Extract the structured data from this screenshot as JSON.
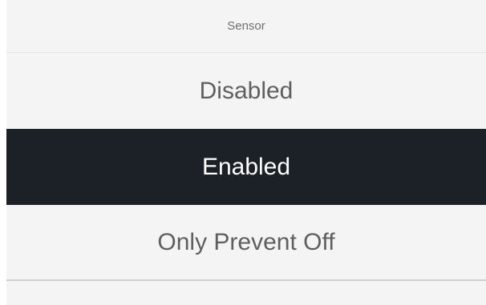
{
  "dialog": {
    "title": "Sensor",
    "options": [
      {
        "label": "Disabled",
        "selected": false
      },
      {
        "label": "Enabled",
        "selected": true
      },
      {
        "label": "Only Prevent Off",
        "selected": false
      }
    ]
  },
  "colors": {
    "panel_bg": "#f4f4f4",
    "selected_bg": "#1c2128",
    "selected_text": "#ffffff",
    "option_text": "#5f5f5f",
    "title_text": "#6f6f6f"
  }
}
